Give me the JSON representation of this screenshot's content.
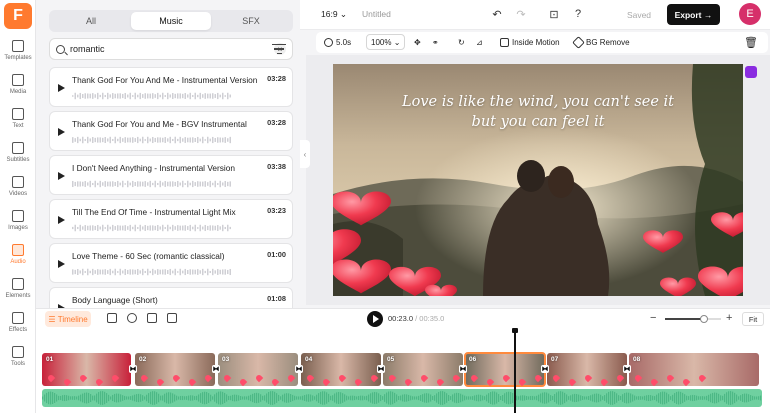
{
  "app": {
    "logo_letter": "F"
  },
  "rail": [
    {
      "label": "Templates",
      "icon": "templates-icon"
    },
    {
      "label": "Media",
      "icon": "media-icon"
    },
    {
      "label": "Text",
      "icon": "text-icon"
    },
    {
      "label": "Subtitles",
      "icon": "subtitles-icon"
    },
    {
      "label": "Videos",
      "icon": "videos-icon"
    },
    {
      "label": "Images",
      "icon": "images-icon"
    },
    {
      "label": "Audio",
      "icon": "audio-icon",
      "active": true
    },
    {
      "label": "Elements",
      "icon": "elements-icon"
    },
    {
      "label": "Effects",
      "icon": "effects-icon"
    },
    {
      "label": "Tools",
      "icon": "tools-icon"
    }
  ],
  "panel": {
    "tabs": [
      "All",
      "Music",
      "SFX"
    ],
    "active_tab": "Music",
    "search": {
      "value": "romantic",
      "placeholder": "Search"
    },
    "tracks": [
      {
        "title": "Thank God For You And Me - Instrumental Version",
        "duration": "03:28"
      },
      {
        "title": "Thank God For You and Me - BGV Instrumental",
        "duration": "03:28"
      },
      {
        "title": "I Don't Need Anything - Instrumental Version",
        "duration": "03:38"
      },
      {
        "title": "Till The End Of Time - Instrumental Light Mix",
        "duration": "03:23"
      },
      {
        "title": "Love Theme - 60 Sec (romantic classical)",
        "duration": "01:00"
      },
      {
        "title": "Body Language (Short)",
        "duration": "01:08"
      }
    ]
  },
  "topbar": {
    "ratio": "16:9",
    "title": "Untitled",
    "saved_label": "Saved",
    "export_label": "Export",
    "avatar_letter": "E"
  },
  "edit_toolbar": {
    "duration": "5.0s",
    "zoom": "100%",
    "inside_motion": "Inside Motion",
    "bg_remove": "BG Remove"
  },
  "canvas": {
    "quote_line1": "Love is like the wind, you can't see it",
    "quote_line2": "but you can feel it"
  },
  "timeline": {
    "label": "Timeline",
    "current_time": "00:23.0",
    "total_time": "00:35.0",
    "fit_label": "Fit",
    "zoom_level": 0.7,
    "clips": [
      "01",
      "02",
      "03",
      "04",
      "05",
      "06",
      "07",
      "08"
    ],
    "selected_clip": "06"
  },
  "colors": {
    "accent": "#ff7a2f",
    "audio": "#6fd0a0",
    "avatar": "#d62f6a"
  }
}
